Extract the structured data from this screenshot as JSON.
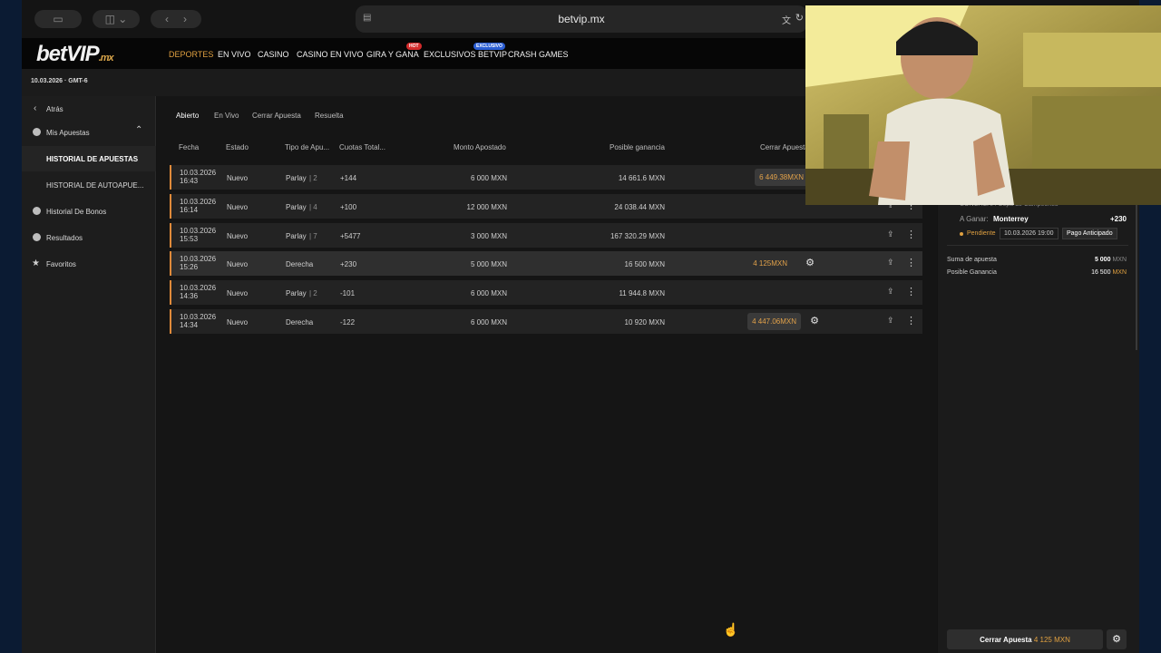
{
  "browser": {
    "url": "betvip.mx"
  },
  "site": {
    "logo": "betVIP",
    "logo_suffix": ".mx",
    "nav": [
      {
        "label": "DEPORTES",
        "active": true
      },
      {
        "label": "EN VIVO"
      },
      {
        "label": "CASINO"
      },
      {
        "label": "CASINO EN VIVO"
      },
      {
        "label": "GIRA Y GANA",
        "badge": "HOT"
      },
      {
        "label": "EXCLUSIVOS BETVIP",
        "badge": "EXCLUSIVO"
      },
      {
        "label": "CRASH GAMES"
      }
    ],
    "date": "10.03.2026 · GMT-6"
  },
  "sidebar": {
    "back": "Atrás",
    "my_bets": "Mis Apuestas",
    "sub1": "HISTORIAL DE APUESTAS",
    "sub2": "HISTORIAL DE AUTOAPUE...",
    "bonus": "Historial De Bonos",
    "results": "Resultados",
    "favorites": "Favoritos"
  },
  "tabs": [
    "Abierto",
    "En Vivo",
    "Cerrar Apuesta",
    "Resuelta"
  ],
  "columns": [
    "Fecha",
    "Estado",
    "Tipo de Apu...",
    "Cuotas Total...",
    "Monto Apostado",
    "Posible ganancia",
    "Cerrar Apuesta"
  ],
  "bets": [
    {
      "date": "10.03.2026",
      "time": "16:43",
      "status": "Nuevo",
      "type": "Parlay",
      "legs": "| 2",
      "odds": "+144",
      "stake": "6 000 MXN",
      "potential": "14 661.6 MXN",
      "cashout": "6 449.38MXN"
    },
    {
      "date": "10.03.2026",
      "time": "16:14",
      "status": "Nuevo",
      "type": "Parlay",
      "legs": "| 4",
      "odds": "+100",
      "stake": "12 000 MXN",
      "potential": "24 038.44 MXN",
      "cashout": ""
    },
    {
      "date": "10.03.2026",
      "time": "15:53",
      "status": "Nuevo",
      "type": "Parlay",
      "legs": "| 7",
      "odds": "+5477",
      "stake": "3 000 MXN",
      "potential": "167 320.29 MXN",
      "cashout": ""
    },
    {
      "date": "10.03.2026",
      "time": "15:26",
      "status": "Nuevo",
      "type": "Derecha",
      "legs": "",
      "odds": "+230",
      "stake": "5 000 MXN",
      "potential": "16 500 MXN",
      "cashout": "4 125MXN"
    },
    {
      "date": "10.03.2026",
      "time": "14:36",
      "status": "Nuevo",
      "type": "Parlay",
      "legs": "| 2",
      "odds": "-101",
      "stake": "6 000 MXN",
      "potential": "11 944.8 MXN",
      "cashout": ""
    },
    {
      "date": "10.03.2026",
      "time": "14:34",
      "status": "Nuevo",
      "type": "Derecha",
      "legs": "",
      "odds": "-122",
      "stake": "6 000 MXN",
      "potential": "10 920 MXN",
      "cashout": "4 447.06MXN"
    }
  ],
  "detail": {
    "league": "CONCACAF. Copa de Campeones",
    "bet_label": "A Ganar:",
    "selection": "Monterrey",
    "odds": "+230",
    "status": "Pendiente",
    "datetime": "10.03.2026 19:00",
    "early_payout": "Pago Anticipado",
    "sum_label": "Suma de apuesta",
    "sum_value": "5 000",
    "potential_label": "Posible Ganancia",
    "potential_value": "16 500",
    "currency": "MXN",
    "cashout_label": "Cerrar Apuesta",
    "cashout_value": "4 125 MXN"
  },
  "colors": {
    "accent": "#e0a040",
    "row_border": "#e08a3a",
    "badge_hot": "#d42b2b",
    "badge_excl": "#2b5ed4"
  }
}
